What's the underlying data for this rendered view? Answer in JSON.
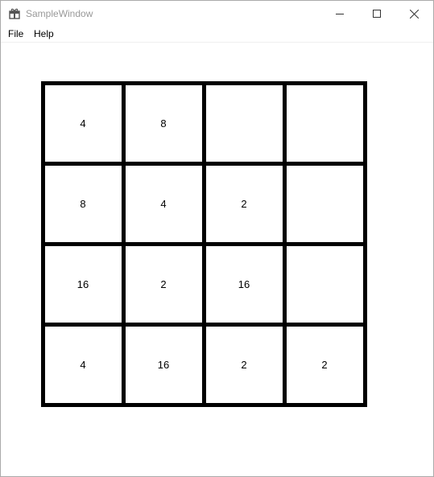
{
  "window": {
    "title": "SampleWindow",
    "icon": "app-icon"
  },
  "menu": {
    "file": "File",
    "help": "Help"
  },
  "board": {
    "rows": 4,
    "cols": 4,
    "tiles": [
      [
        "4",
        "8",
        "",
        ""
      ],
      [
        "8",
        "4",
        "2",
        ""
      ],
      [
        "16",
        "2",
        "16",
        ""
      ],
      [
        "4",
        "16",
        "2",
        "2"
      ]
    ]
  }
}
